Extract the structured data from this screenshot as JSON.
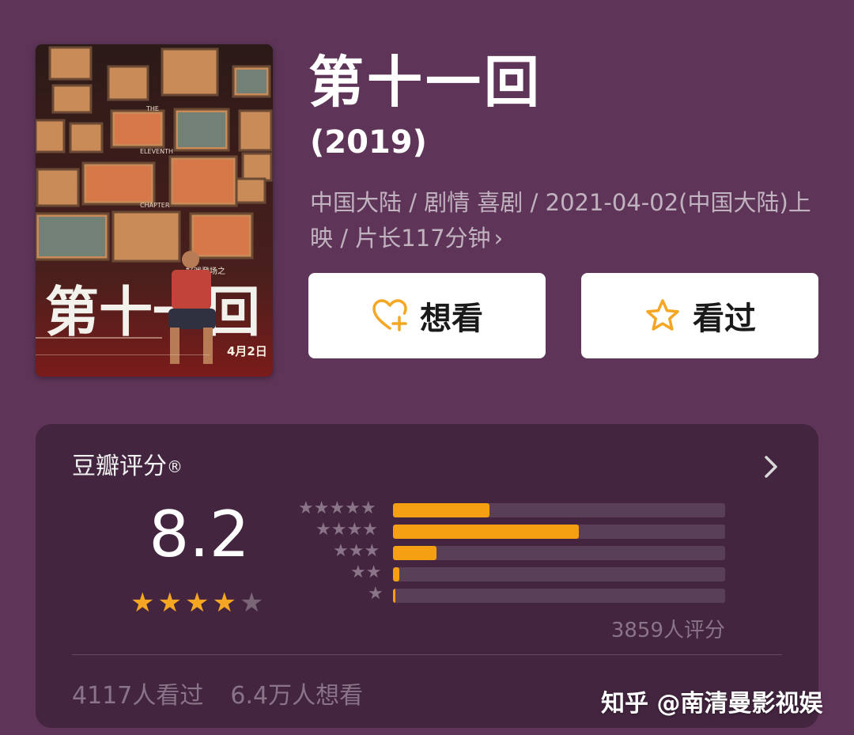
{
  "movie": {
    "title": "第十一回",
    "year": "(2019)",
    "meta_line": "中国大陆 / 剧情 喜剧 / 2021-04-02(中国大陆)上映 / 片长117分钟",
    "meta_chevron": "›",
    "poster": {
      "title_text": "第十一回",
      "side_text": [
        "THE",
        "ELEVENTH",
        "CHAPTER"
      ],
      "tagline": "好戏登场之",
      "release": "4月2日"
    }
  },
  "actions": {
    "want_label": "想看",
    "seen_label": "看过",
    "want_icon": "heart-plus-icon",
    "seen_icon": "star-outline-icon",
    "accent": "#f5a623"
  },
  "rating": {
    "header": "豆瓣评分",
    "header_mark": "®",
    "score": "8.2",
    "stars_filled": 4,
    "stars_total": 5,
    "distribution": [
      {
        "stars": 5,
        "label": "★★★★★",
        "fraction": 0.29
      },
      {
        "stars": 4,
        "label": "★★★★",
        "fraction": 0.56
      },
      {
        "stars": 3,
        "label": "★★★",
        "fraction": 0.13
      },
      {
        "stars": 2,
        "label": "★★",
        "fraction": 0.02
      },
      {
        "stars": 1,
        "label": "★",
        "fraction": 0.005
      }
    ],
    "count_text": "3859人评分",
    "seen_text": "4117人看过",
    "want_text": "6.4万人想看"
  },
  "watermark": "知乎 @南清曼影视娱",
  "colors": {
    "background": "#5e3558",
    "card": "#43253f",
    "bar_fill": "#f5a012",
    "bar_track": "#5a4057"
  }
}
